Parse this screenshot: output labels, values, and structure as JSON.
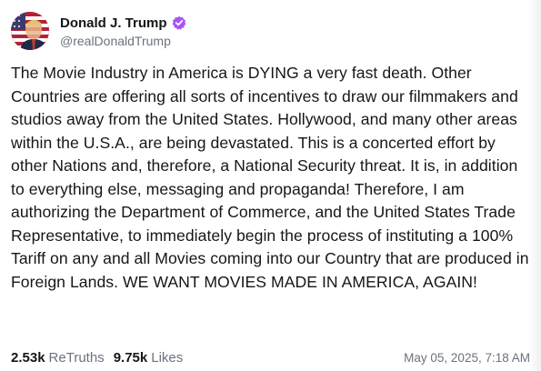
{
  "post": {
    "author": {
      "display_name": "Donald J. Trump",
      "handle": "@realDonaldTrump",
      "avatar_icon": "flag-portrait-avatar",
      "verified_icon": "verified-badge-icon",
      "verified_color": "#a855f7"
    },
    "text": "The Movie Industry in America is DYING a very fast death. Other Countries are offering all sorts of incentives to draw our filmmakers and studios away from the United States. Hollywood, and many other areas within the U.S.A., are being devastated. This is a concerted effort by other Nations and, therefore, a National Security threat. It is, in addition to everything else, messaging and propaganda! Therefore, I am authorizing the Department of Commerce, and the United States Trade Representative, to immediately begin the process of instituting a 100% Tariff on any and all Movies coming into our Country that are produced in Foreign Lands. WE WANT MOVIES MADE IN AMERICA, AGAIN!",
    "stats": {
      "retruths_count": "2.53k",
      "retruths_label": "ReTruths",
      "likes_count": "9.75k",
      "likes_label": "Likes"
    },
    "timestamp": "May 05, 2025, 7:18 AM"
  }
}
